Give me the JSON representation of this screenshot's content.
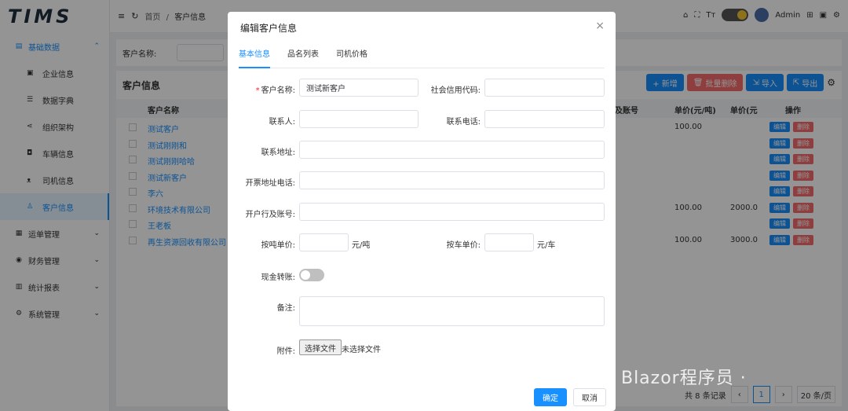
{
  "app": {
    "logo": "TIMS"
  },
  "sidebar": {
    "items": [
      {
        "label": "基础数据",
        "icon": "database-icon",
        "open": true
      },
      {
        "label": "运单管理",
        "icon": "waybill-icon"
      },
      {
        "label": "财务管理",
        "icon": "finance-icon"
      },
      {
        "label": "统计报表",
        "icon": "chart-icon"
      },
      {
        "label": "系统管理",
        "icon": "settings-icon"
      }
    ],
    "sub_items": [
      {
        "label": "企业信息",
        "icon": "company-icon"
      },
      {
        "label": "数据字典",
        "icon": "dictionary-icon"
      },
      {
        "label": "组织架构",
        "icon": "org-icon"
      },
      {
        "label": "车辆信息",
        "icon": "vehicle-icon"
      },
      {
        "label": "司机信息",
        "icon": "driver-icon"
      },
      {
        "label": "客户信息",
        "icon": "customer-icon",
        "active": true
      }
    ]
  },
  "topbar": {
    "breadcrumb": {
      "home": "首页",
      "sep": "/",
      "current": "客户信息"
    },
    "user": "Admin"
  },
  "main": {
    "filter_label": "客户名称:",
    "panel_title": "客户信息",
    "buttons": {
      "add": "+ 新增",
      "batch_delete": "批量删除",
      "import": "导入",
      "export": "导出"
    },
    "columns": {
      "name": "客户名称",
      "account": "及账号",
      "price_ton": "单价(元/吨)",
      "price_car": "单价(元",
      "ops": "操作"
    },
    "rows": [
      {
        "name": "测试客户",
        "v1": "100.00",
        "v2": ""
      },
      {
        "name": "测试刚刚和",
        "v1": "",
        "v2": ""
      },
      {
        "name": "测试刚刚哈哈",
        "v1": "",
        "v2": ""
      },
      {
        "name": "测试新客户",
        "v1": "",
        "v2": ""
      },
      {
        "name": "李六",
        "v1": "",
        "v2": ""
      },
      {
        "name": "环境技术有限公司",
        "v1": "100.00",
        "v2": "2000.0"
      },
      {
        "name": "王老板",
        "v1": "",
        "v2": ""
      },
      {
        "name": "再生资源回收有限公司",
        "v1": "100.00",
        "v2": "3000.0"
      }
    ],
    "edit_label": "编辑",
    "delete_label": "删除",
    "pager": {
      "total": "共 8 条记录",
      "page": "1",
      "size": "20 条/页"
    }
  },
  "modal": {
    "title": "编辑客户信息",
    "close": "×",
    "tabs": [
      "基本信息",
      "品名列表",
      "司机价格"
    ],
    "fields": {
      "customer_name": {
        "label": "客户名称:",
        "value": "测试新客户",
        "required": "*"
      },
      "credit_code": {
        "label": "社会信用代码:",
        "value": ""
      },
      "contact": {
        "label": "联系人:",
        "value": ""
      },
      "phone": {
        "label": "联系电话:",
        "value": ""
      },
      "address": {
        "label": "联系地址:",
        "value": ""
      },
      "invoice_addr_phone": {
        "label": "开票地址电话:",
        "value": ""
      },
      "bank_account": {
        "label": "开户行及账号:",
        "value": ""
      },
      "price_ton": {
        "label": "按吨单价:",
        "value": "",
        "unit": "元/吨"
      },
      "price_car": {
        "label": "按车单价:",
        "value": "",
        "unit": "元/车"
      },
      "cash_transfer": {
        "label": "现金转账:",
        "on": false
      },
      "remark": {
        "label": "备注:",
        "value": ""
      },
      "attachment": {
        "label": "附件:",
        "button": "选择文件",
        "status": "未选择文件"
      }
    },
    "ok": "确定",
    "cancel": "取消"
  },
  "watermark": "公众号 · Blazor程序员 ·",
  "colors": {
    "primary": "#1890ff",
    "danger": "#f56c6c"
  }
}
